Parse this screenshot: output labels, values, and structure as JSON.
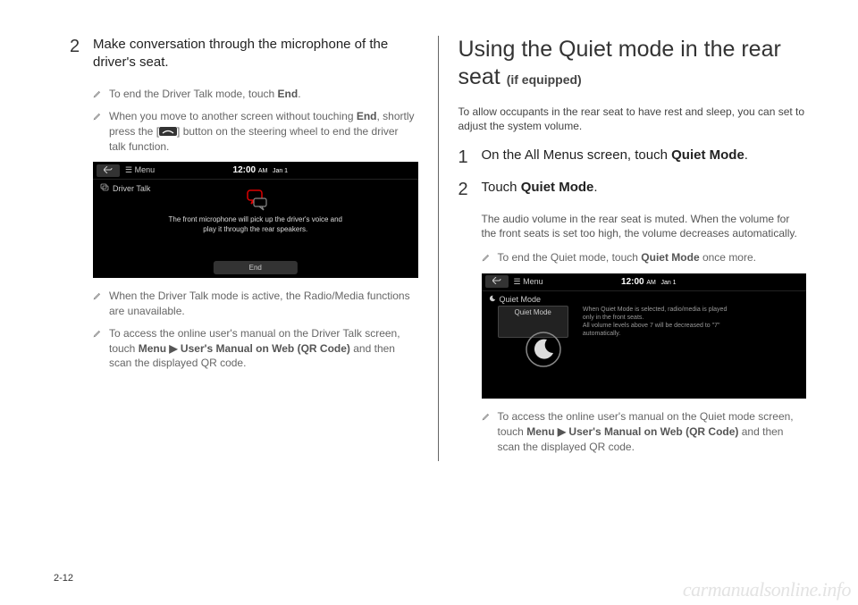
{
  "left": {
    "step2_num": "2",
    "step2_text": "Make conversation through the microphone of the driver's seat.",
    "note1_a": "To end the Driver Talk mode, touch ",
    "note1_b": "End",
    "note1_c": ".",
    "note2_a": "When you move to another screen without touching ",
    "note2_b": "End",
    "note2_c": ", shortly press the [",
    "note2_d": "] button on the steering wheel to end the driver talk function.",
    "ss": {
      "menu": "Menu",
      "clock": "12:00",
      "clock_ampm": "AM",
      "clock_date": "Jan 1",
      "title": "Driver Talk",
      "msg_l1": "The front microphone will pick up the driver's voice and",
      "msg_l2": "play it through the rear speakers.",
      "end": "End"
    },
    "note3": "When the Driver Talk mode is active, the Radio/Media functions are unavailable.",
    "note4_a": "To access the online user's manual on the Driver Talk screen, touch ",
    "note4_b": "Menu ▶ User's Manual on Web (QR Code)",
    "note4_c": " and then scan the displayed QR code."
  },
  "right": {
    "heading_a": "Using the Quiet mode in the rear seat ",
    "heading_b": "(if equipped)",
    "intro": "To allow occupants in the rear seat to have rest and sleep, you can set to adjust the system volume.",
    "step1_num": "1",
    "step1_a": "On the All Menus screen, touch ",
    "step1_b": "Quiet Mode",
    "step1_c": ".",
    "step2_num": "2",
    "step2_a": "Touch ",
    "step2_b": "Quiet Mode",
    "step2_c": ".",
    "step2_desc": "The audio volume in the rear seat is muted. When the volume for the front seats is set too high, the volume decreases automatically.",
    "note1_a": "To end the Quiet mode, touch ",
    "note1_b": "Quiet Mode",
    "note1_c": " once more.",
    "ss": {
      "menu": "Menu",
      "clock": "12:00",
      "clock_ampm": "AM",
      "clock_date": "Jan 1",
      "title": "Quiet Mode",
      "quiet_btn": "Quiet Mode",
      "desc_l1": "When Quiet Mode is selected, radio/media is played",
      "desc_l2": "only in the front seats.",
      "desc_l3": "All volume levels above 7 will be decreased to \"7\"",
      "desc_l4": "automatically."
    },
    "note2_a": "To access the online user's manual on the Quiet mode screen, touch ",
    "note2_b": "Menu ▶ User's Manual on Web (QR Code)",
    "note2_c": " and then scan the displayed QR code."
  },
  "page_num": "2-12",
  "watermark": "carmanualsonline.info"
}
